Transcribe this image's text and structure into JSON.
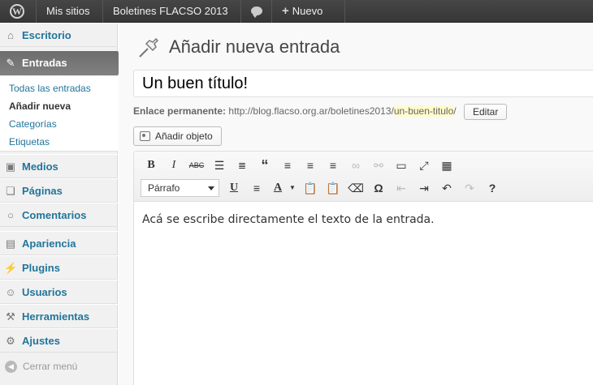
{
  "adminbar": {
    "sites_label": "Mis sitios",
    "site_name": "Boletines FLACSO 2013",
    "new_label": "Nuevo"
  },
  "sidebar": {
    "items": [
      {
        "label": "Escritorio",
        "icon": "home-icon"
      },
      {
        "label": "Entradas",
        "icon": "pushpin-icon"
      },
      {
        "label": "Medios",
        "icon": "media-icon"
      },
      {
        "label": "Páginas",
        "icon": "pages-icon"
      },
      {
        "label": "Comentarios",
        "icon": "comments-icon"
      },
      {
        "label": "Apariencia",
        "icon": "appearance-icon"
      },
      {
        "label": "Plugins",
        "icon": "plugins-icon"
      },
      {
        "label": "Usuarios",
        "icon": "users-icon"
      },
      {
        "label": "Herramientas",
        "icon": "tools-icon"
      },
      {
        "label": "Ajustes",
        "icon": "settings-icon"
      }
    ],
    "submenu": [
      "Todas las entradas",
      "Añadir nueva",
      "Categorías",
      "Etiquetas"
    ],
    "collapse_label": "Cerrar menú"
  },
  "main": {
    "page_title": "Añadir nueva entrada",
    "title_value": "Un buen título!",
    "permalink_label": "Enlace permanente:",
    "permalink_base": "http://blog.flacso.org.ar/boletines2013/",
    "permalink_slug": "un-buen-titulo",
    "permalink_end": "/",
    "edit_button": "Editar",
    "add_media_button": "Añadir objeto",
    "format_select": "Párrafo",
    "content_text": "Acá se escribe directamente el texto de la entrada."
  },
  "colors": {
    "link": "#21759b",
    "adminbar_bg": "#464646",
    "active_menu": "#7a7a7a",
    "slug_highlight": "#fffbcc"
  }
}
